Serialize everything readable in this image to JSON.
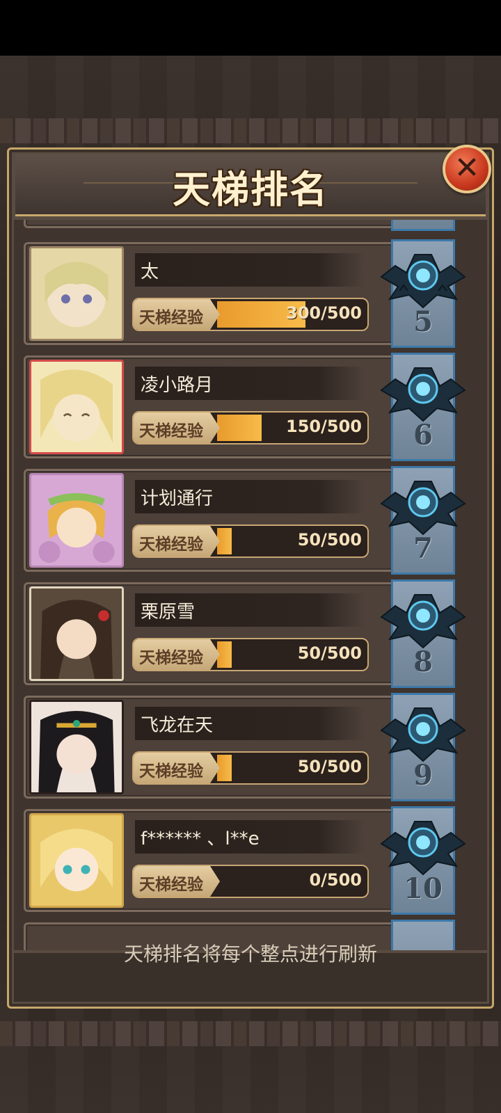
{
  "title": "天梯排名",
  "close_icon": "close-icon",
  "exp_label": "天梯经验",
  "footer": "天梯排名将每个整点进行刷新",
  "rows": [
    {
      "rank": "5",
      "name": "太",
      "exp": "300/500",
      "progress": 0.6
    },
    {
      "rank": "6",
      "name": "凌小路月",
      "exp": "150/500",
      "progress": 0.3
    },
    {
      "rank": "7",
      "name": "计划通行",
      "exp": "50/500",
      "progress": 0.1
    },
    {
      "rank": "8",
      "name": "栗原雪",
      "exp": "50/500",
      "progress": 0.1
    },
    {
      "rank": "9",
      "name": "飞龙在天",
      "exp": "50/500",
      "progress": 0.1
    },
    {
      "rank": "10",
      "name": "f****** 、l**e",
      "exp": "0/500",
      "progress": 0.0
    }
  ],
  "colors": {
    "panel": "#594c42",
    "gold_border": "#c9a773",
    "exp_fill": "#f0a83a",
    "close_button": "#d8452a",
    "rank_column": "#7f93a6"
  }
}
